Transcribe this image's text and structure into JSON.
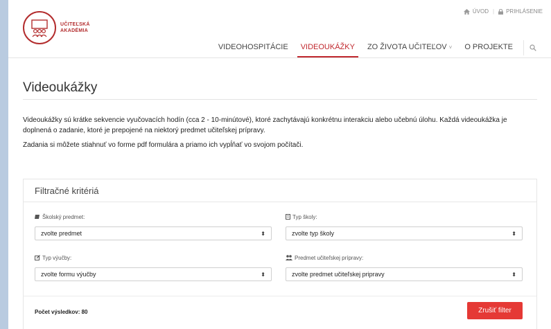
{
  "header": {
    "logo": {
      "line1": "UČITEĽSKÁ",
      "line2": "AKADÉMIA"
    },
    "toplinks": {
      "home_label": "ÚVOD",
      "login_label": "PRIHLÁSENIE"
    },
    "nav": [
      {
        "label": "VIDEOHOSPITÁCIE",
        "active": false
      },
      {
        "label": "VIDEOUKÁŽKY",
        "active": true
      },
      {
        "label": "ZO ŽIVOTA UČITEĽOV",
        "active": false,
        "has_dropdown": true
      },
      {
        "label": "O PROJEKTE",
        "active": false
      }
    ],
    "accent_color": "#c0272d"
  },
  "main": {
    "title": "Videoukážky",
    "paragraphs": [
      "Videoukážky sú krátke sekvencie vyučovacích hodín (cca 2 - 10-minútové), ktoré zachytávajú konkrétnu interakciu alebo učebnú úlohu. Každá videoukážka je doplnená o zadanie, ktoré je prepojené na niektorý predmet učiteľskej prípravy.",
      "Zadania si môžete stiahnuť vo forme pdf formulára a priamo ich vypĺňať vo svojom počítači."
    ]
  },
  "filters": {
    "heading": "Filtračné kritériá",
    "fields": [
      {
        "icon": "book-icon",
        "label": "Školský predmet:",
        "value": "zvolte predmet"
      },
      {
        "icon": "building-icon",
        "label": "Typ školy:",
        "value": "zvolte typ školy"
      },
      {
        "icon": "edit-icon",
        "label": "Typ výučby:",
        "value": "zvolte formu výučby"
      },
      {
        "icon": "users-icon",
        "label": "Predmet učiteľskej prípravy:",
        "value": "zvolte predmet učiteľskej pripravy"
      }
    ],
    "result_label": "Počet výsledkov:",
    "result_count": "80",
    "reset_label": "Zrušiť filter",
    "reset_color": "#e53935"
  }
}
